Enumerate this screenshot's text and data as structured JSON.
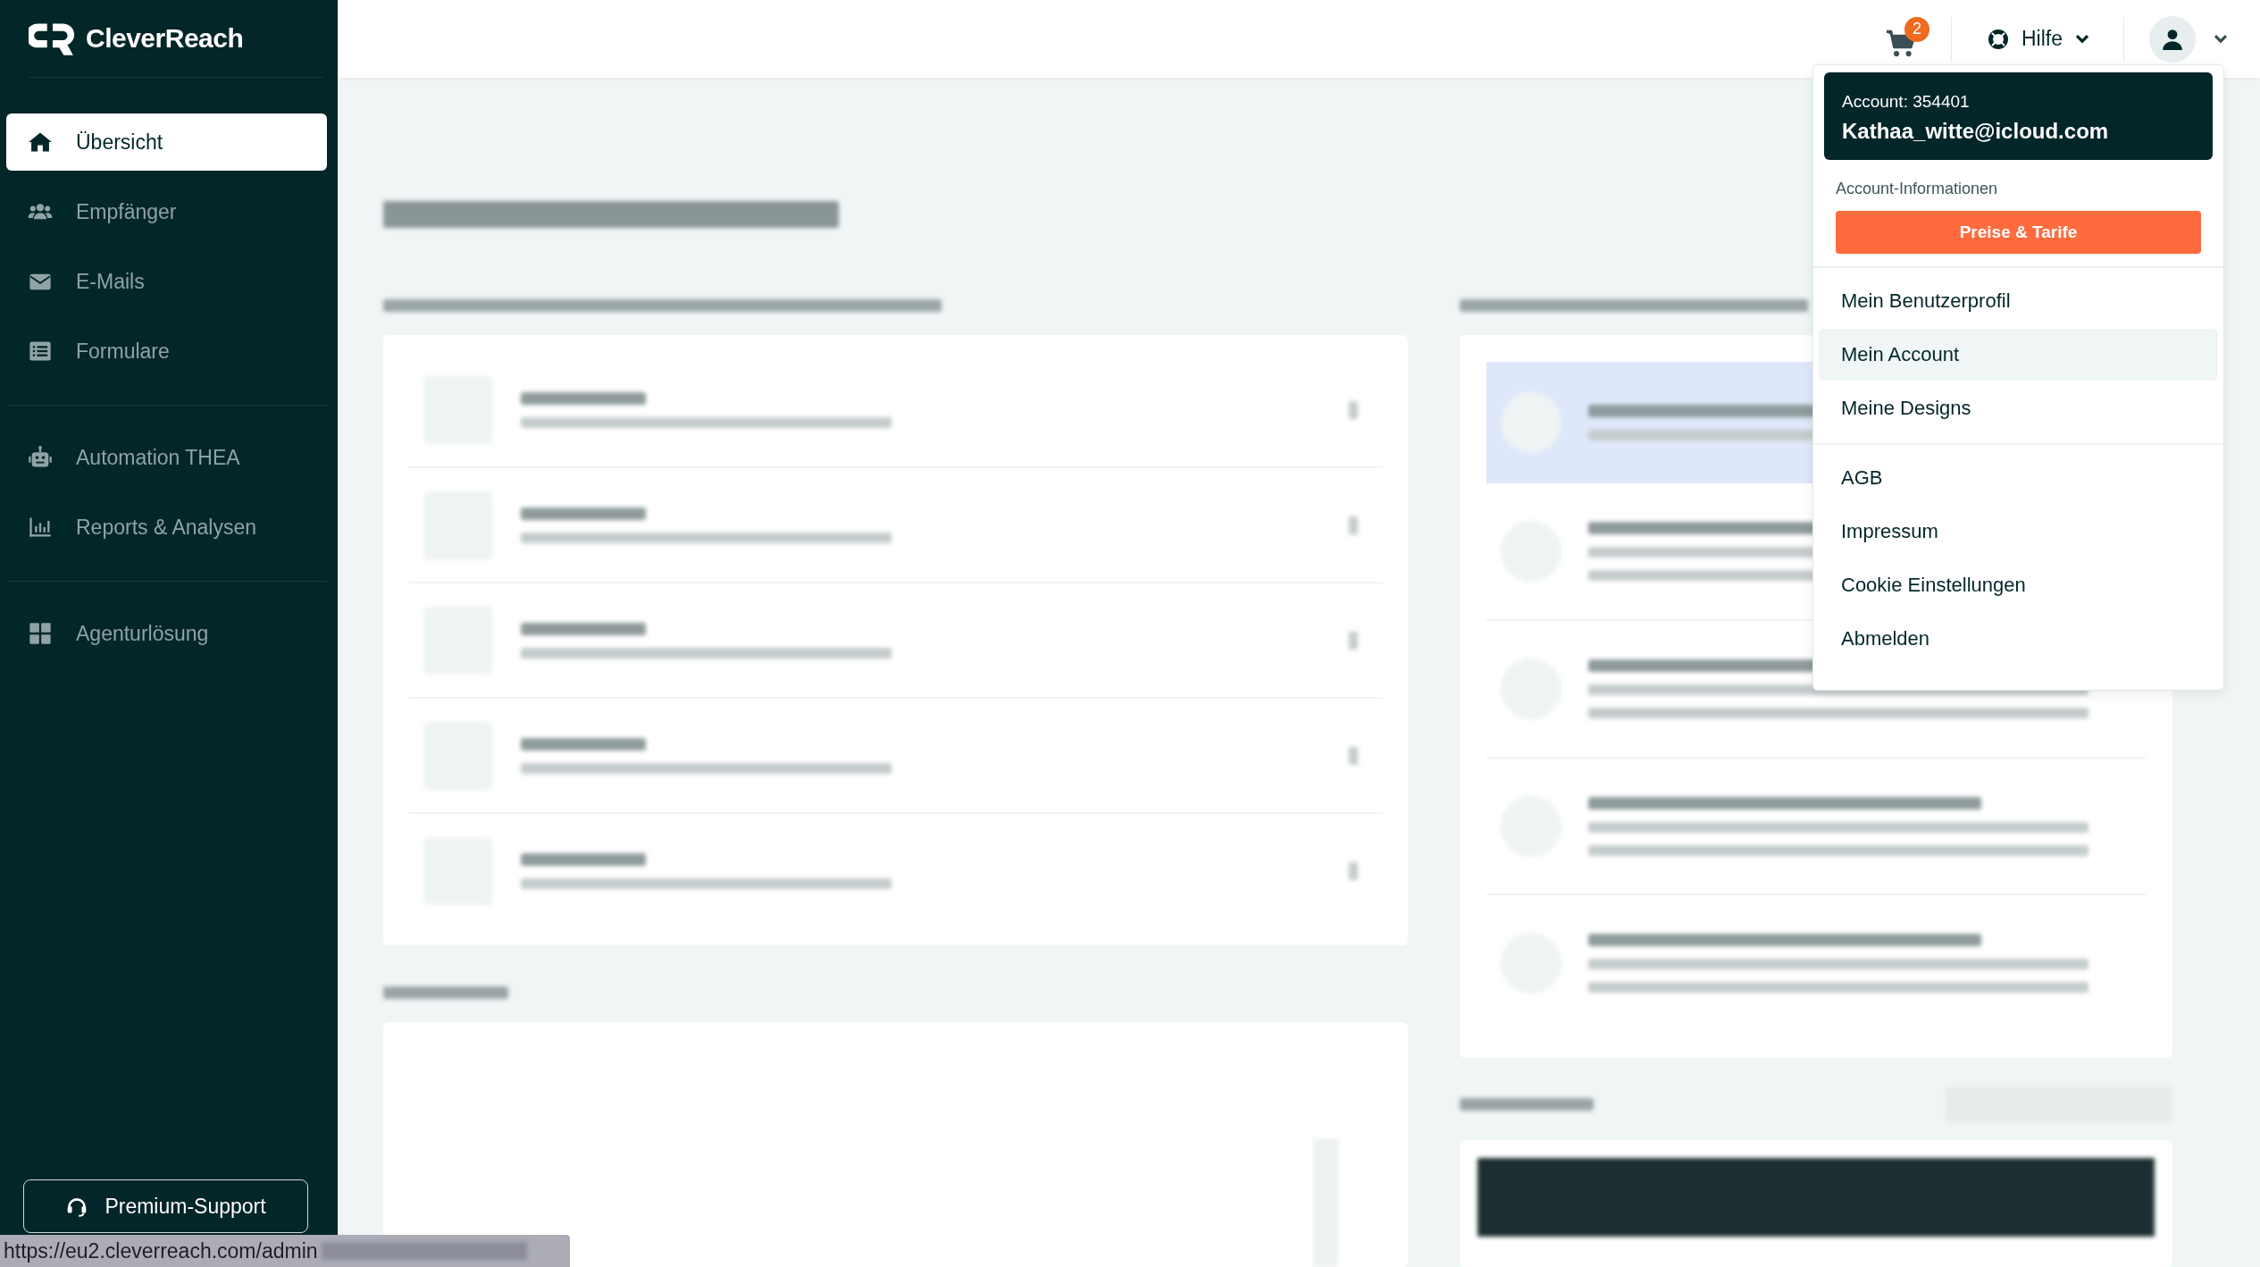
{
  "sidebar": {
    "logo": "CleverReach",
    "groups": [
      [
        {
          "label": "Übersicht",
          "selected": true
        },
        {
          "label": "Empfänger",
          "selected": false
        },
        {
          "label": "E-Mails",
          "selected": false
        },
        {
          "label": "Formulare",
          "selected": false
        }
      ],
      [
        {
          "label": "Automation THEA",
          "selected": false
        },
        {
          "label": "Reports & Analysen",
          "selected": false
        }
      ],
      [
        {
          "label": "Agenturlösung",
          "selected": false
        }
      ]
    ],
    "support_button": "Premium-Support"
  },
  "header": {
    "cart_badge": "2",
    "help": "Hilfe"
  },
  "account_menu": {
    "account": "Account: 354401",
    "email": "Kathaa_witte@icloud.com",
    "section": "Account-Informationen",
    "pricing_button": "Preise & Tarife",
    "groups": [
      [
        {
          "label": "Mein Benutzerprofil",
          "highlighted": false
        },
        {
          "label": "Mein Account",
          "highlighted": true
        },
        {
          "label": "Meine Designs",
          "highlighted": false
        }
      ],
      [
        {
          "label": "AGB",
          "highlighted": false
        },
        {
          "label": "Impressum",
          "highlighted": false
        },
        {
          "label": "Cookie Einstellungen",
          "highlighted": false
        },
        {
          "label": "Abmelden",
          "highlighted": false
        }
      ]
    ]
  },
  "status_bar": {
    "url": "https://eu2.cleverreach.com/admin"
  }
}
